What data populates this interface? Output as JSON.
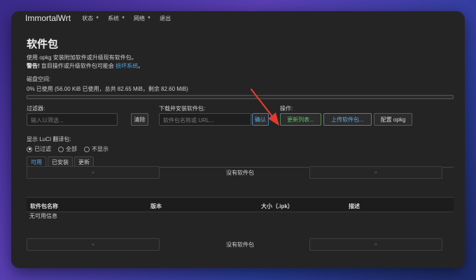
{
  "navbar": {
    "brand": "ImmortalWrt",
    "items": [
      {
        "label": "状态",
        "has_menu": true
      },
      {
        "label": "系统",
        "has_menu": true
      },
      {
        "label": "网络",
        "has_menu": true
      },
      {
        "label": "退出",
        "has_menu": false
      }
    ]
  },
  "page": {
    "title": "软件包",
    "description": "使用 opkg 安装附加软件或升级现有软件包。",
    "warning_prefix": "警告!",
    "warning_text": " 盲目操作或升级软件包可能会 ",
    "warning_link": "损坏系统",
    "warning_suffix": "。"
  },
  "disk": {
    "label": "磁盘空间:",
    "info": "0% 已使用 (56.00 KiB 已使用，总共 82.65 MiB，剩余 82.60 MiB)",
    "used_fraction": 0.0
  },
  "filter": {
    "label": "过滤器:",
    "placeholder": "输入以筛选...",
    "clear_label": "清除"
  },
  "install": {
    "label": "下载并安装软件包:",
    "placeholder": "软件包名称或 URL...",
    "confirm_label": "确认"
  },
  "actions": {
    "label": "操作:",
    "update_label": "更新列表...",
    "upload_label": "上传软件包...",
    "config_label": "配置 opkg"
  },
  "translations": {
    "label": "显示 LuCI 翻译包:",
    "options": [
      {
        "label": "已过滤",
        "selected": true
      },
      {
        "label": "全部",
        "selected": false
      },
      {
        "label": "不显示",
        "selected": false
      }
    ]
  },
  "tabs": [
    {
      "label": "可用",
      "active": true
    },
    {
      "label": "已安装",
      "active": false
    },
    {
      "label": "更新",
      "active": false
    }
  ],
  "pager": {
    "prev_symbol": "«",
    "next_symbol": "»",
    "status": "没有软件包"
  },
  "table": {
    "columns": [
      "软件包名称",
      "版本",
      "大小（.ipk）",
      "描述"
    ],
    "empty_message": "无可用信息"
  },
  "colors": {
    "accent_blue": "#5aaae6",
    "accent_green": "#5cc26a",
    "annotation_red": "#e23b2e"
  }
}
